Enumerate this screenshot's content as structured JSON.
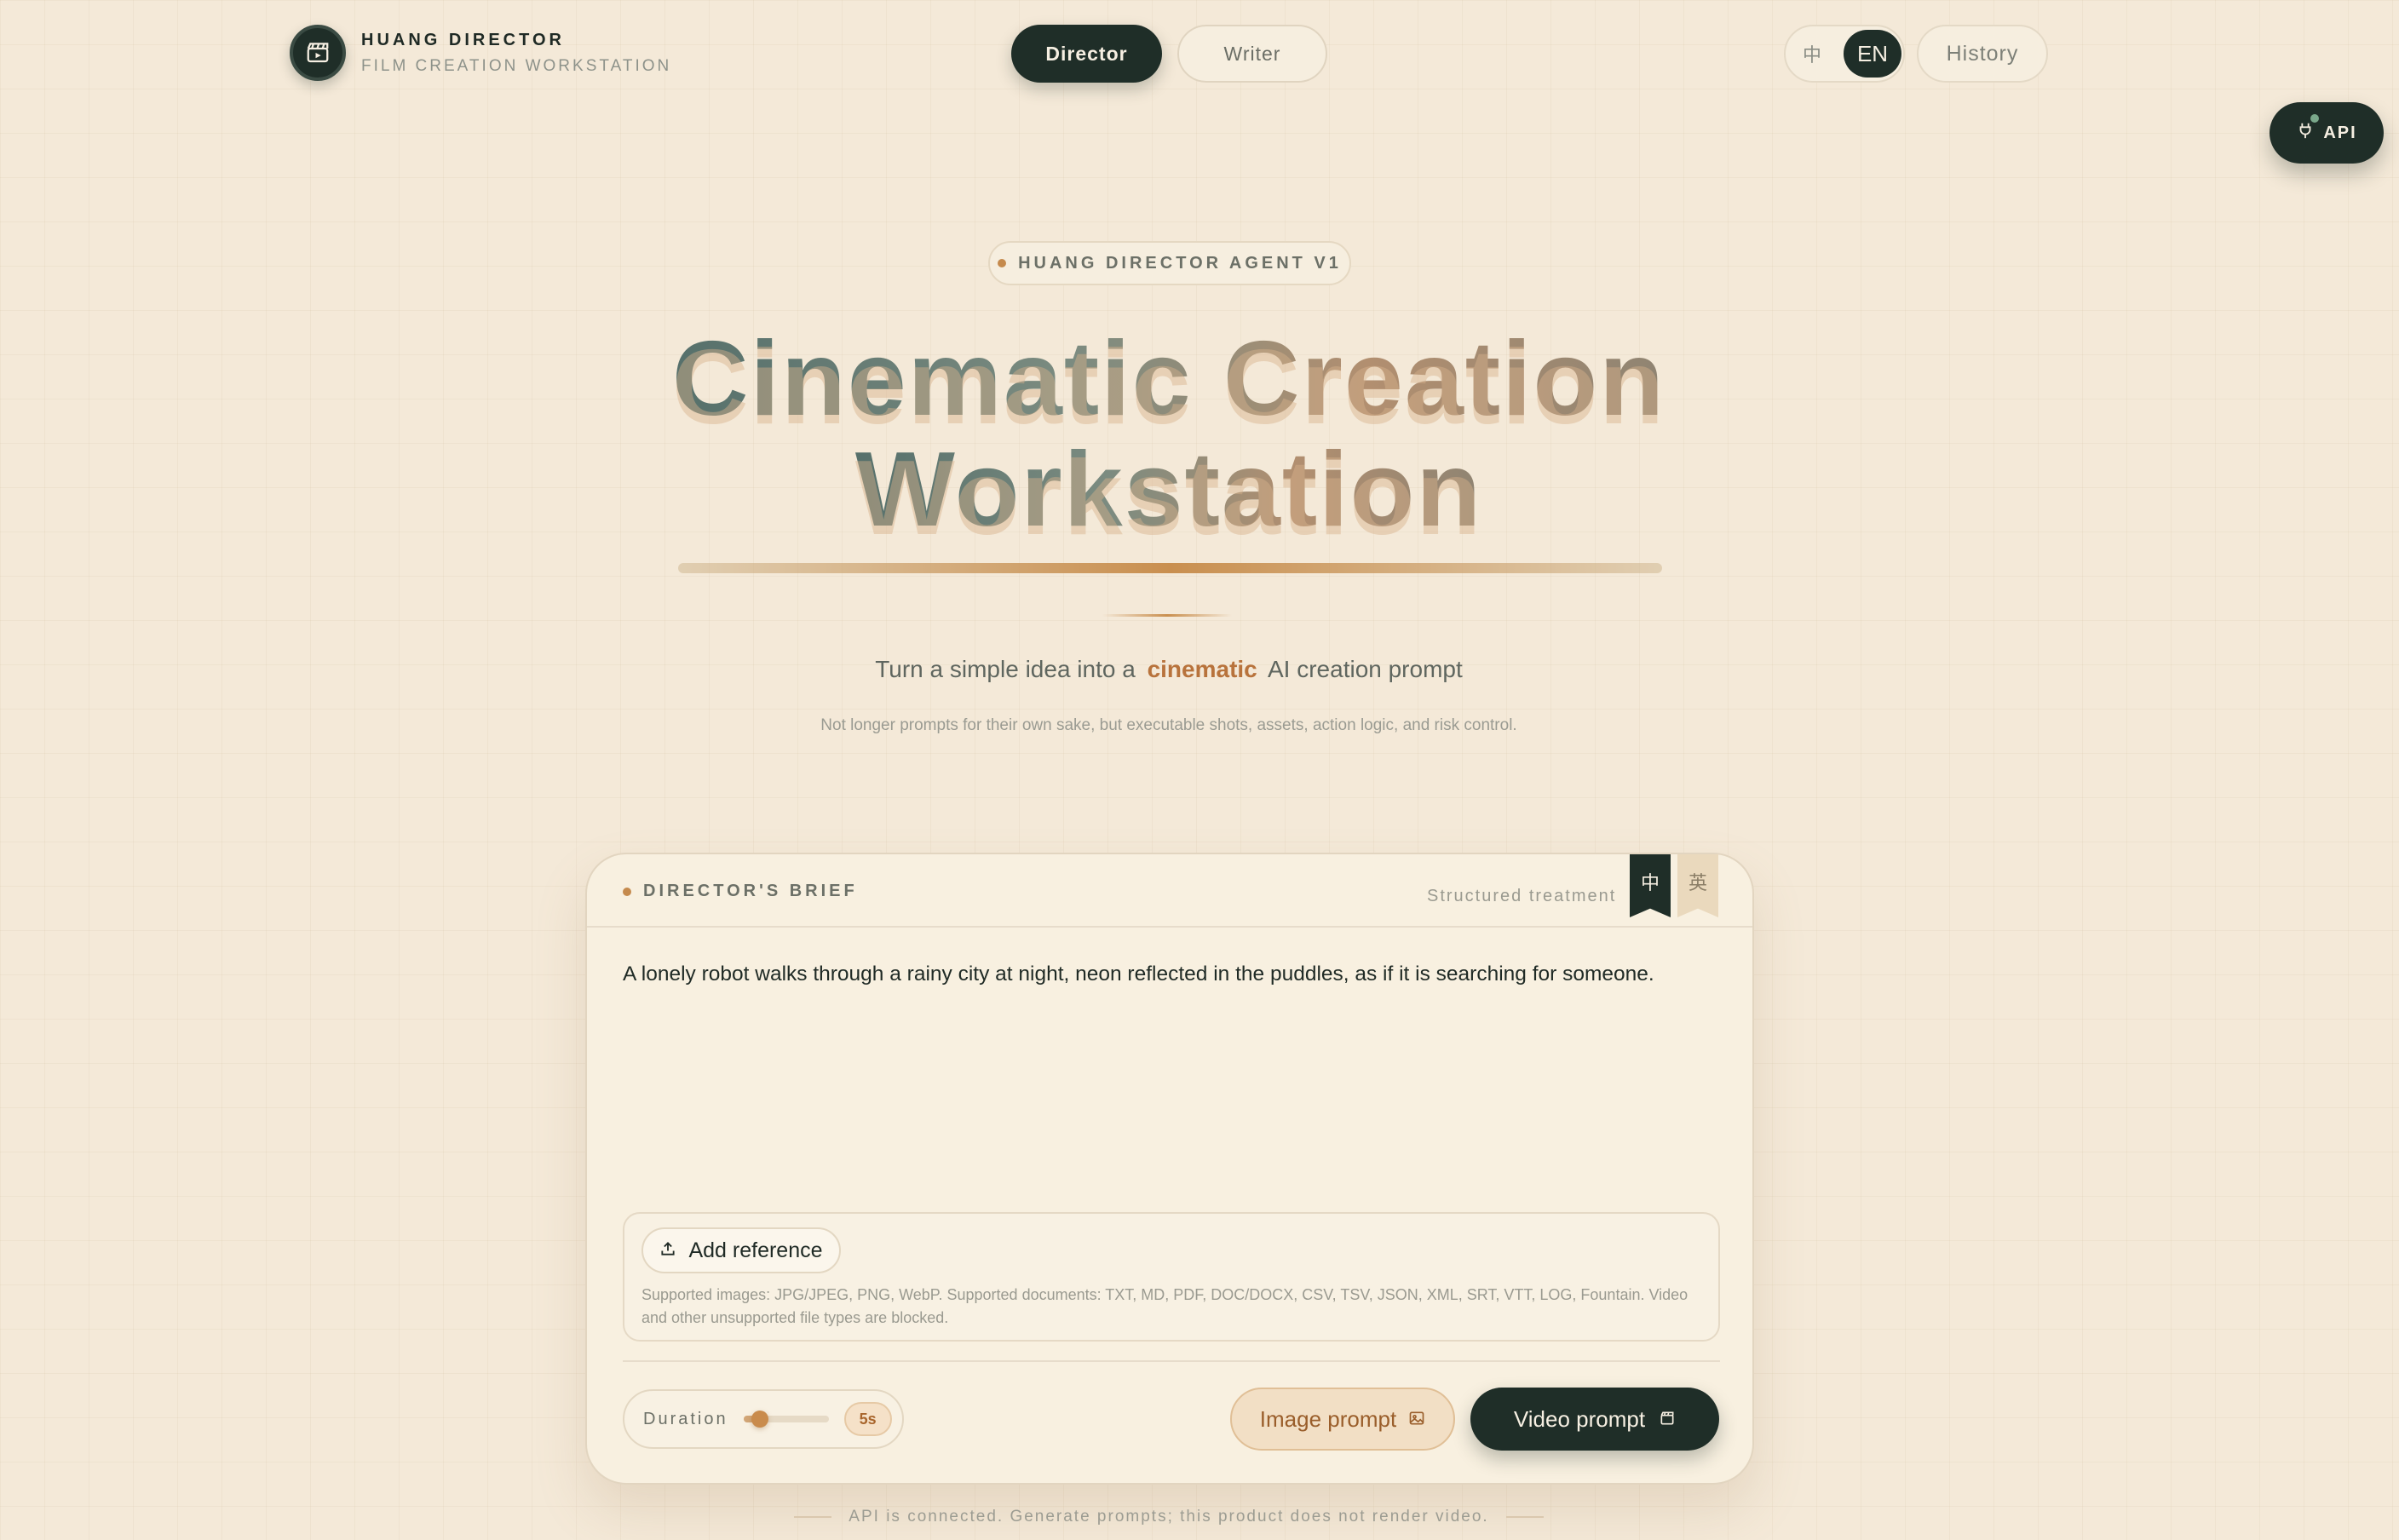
{
  "brand": {
    "title": "HUANG DIRECTOR",
    "subtitle": "FILM CREATION WORKSTATION",
    "logo_icon": "clapperboard-icon"
  },
  "nav": {
    "director": "Director",
    "writer": "Writer",
    "active": "Director"
  },
  "lang": {
    "zh": "中",
    "en": "EN",
    "active": "EN"
  },
  "history_label": "History",
  "api": {
    "label": "API",
    "icon": "plug-icon",
    "status_color": "#7aa88b"
  },
  "hero": {
    "badge": "HUANG DIRECTOR AGENT V1",
    "title_line1": "Cinematic Creation",
    "title_line2": "Workstation",
    "tagline_before": "Turn a simple idea into a",
    "tagline_accent": "cinematic",
    "tagline_after": "AI creation prompt",
    "subline": "Not longer prompts for their own sake, but executable shots, assets, action logic, and risk control."
  },
  "brief": {
    "label": "DIRECTOR'S BRIEF",
    "mode": "Structured treatment",
    "lang_tabs": [
      "中",
      "英"
    ],
    "active_lang": "中",
    "text": "A lonely robot walks through a rainy city at night, neon reflected in the puddles, as if it is searching for someone.",
    "add_reference": "Add reference",
    "reference_note": "Supported images: JPG/JPEG, PNG, WebP. Supported documents: TXT, MD, PDF, DOC/DOCX, CSV, TSV, JSON, XML, SRT, VTT, LOG, Fountain. Video and other unsupported file types are blocked.",
    "duration_label": "Duration",
    "duration_value": "5s",
    "duration_fraction": 0.12,
    "image_prompt": "Image prompt",
    "video_prompt": "Video prompt"
  },
  "footer": "API is connected. Generate prompts; this product does not render video.",
  "colors": {
    "accent": "#c98f4f",
    "dark": "#1f2e28",
    "background": "#f4e9d8"
  }
}
